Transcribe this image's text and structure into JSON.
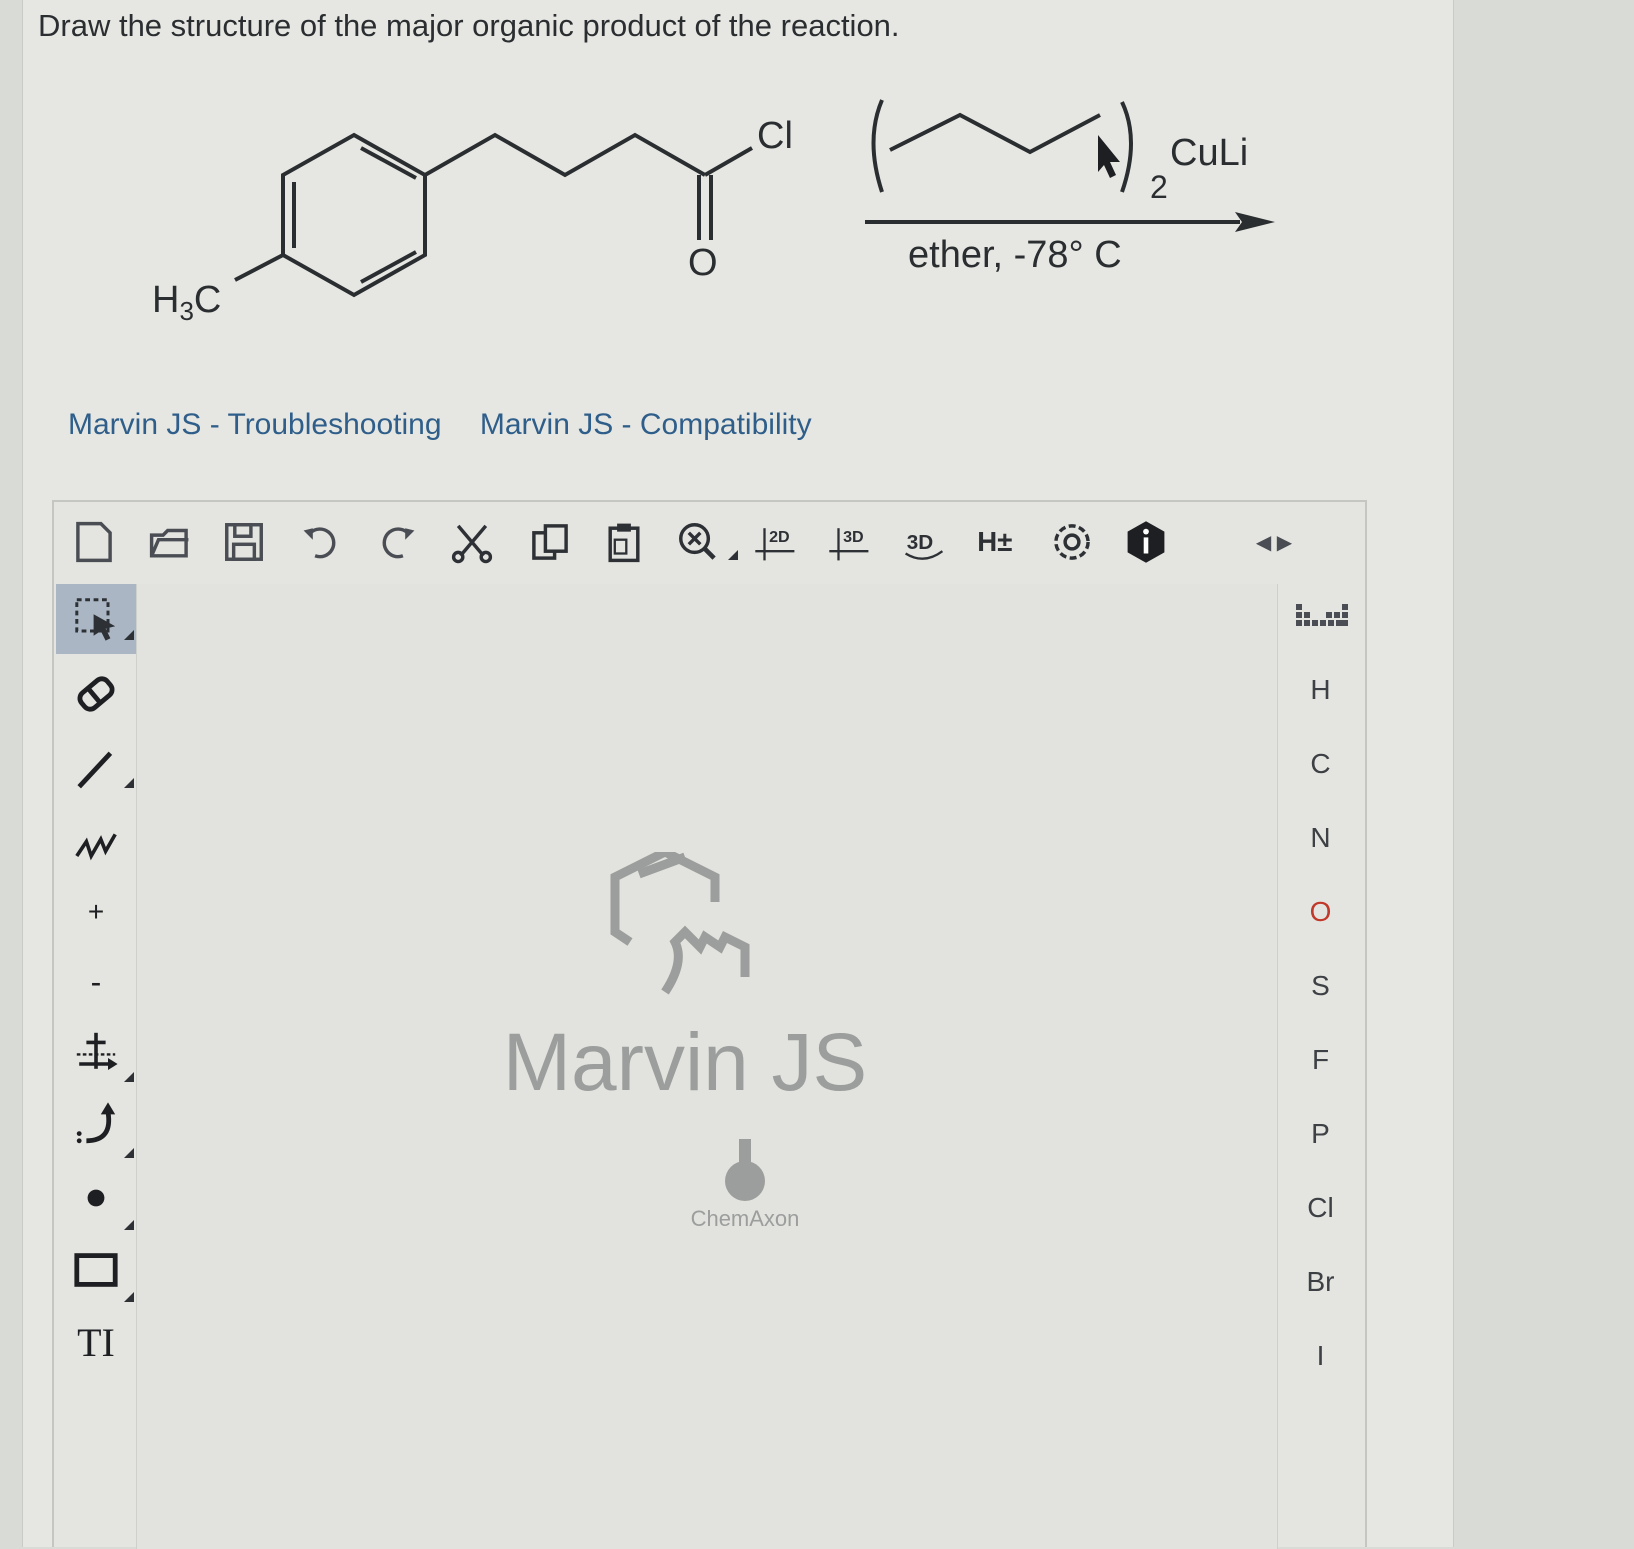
{
  "question": {
    "text": "Draw the structure of the major organic product of the reaction."
  },
  "reaction": {
    "reactant_labels": {
      "h3c": "H",
      "h3c_sub": "3",
      "h3c_c": "C",
      "cl": "Cl",
      "o": "O"
    },
    "reagent": {
      "cu": "CuLi",
      "subscript": "2"
    },
    "conditions": "ether, -78° C"
  },
  "links": [
    {
      "label": "Marvin JS - Troubleshooting"
    },
    {
      "label": "Marvin JS - Compatibility"
    }
  ],
  "toolbar": {
    "items": [
      "new-document-icon",
      "open-icon",
      "save-icon",
      "undo-icon",
      "redo-icon",
      "cut-icon",
      "copy-icon",
      "paste-icon",
      "zoom-icon",
      "clean-2d-icon",
      "clean-3d-icon",
      "3d-rotate-icon",
      "hydrogens-icon",
      "settings-icon",
      "info-icon"
    ],
    "labels": {
      "clean2d": "2D",
      "clean3d": "3D",
      "rot3d": "3D",
      "hydrogens": "H±"
    },
    "expand": "◀ ▶"
  },
  "left_toolbar": {
    "items": [
      "select-icon",
      "erase-icon",
      "single-bond-icon",
      "chain-icon",
      "increase-charge-icon",
      "decrease-charge-icon",
      "reaction-arrow-icon",
      "electron-flow-icon",
      "radical-icon",
      "rectangle-icon",
      "text-icon"
    ],
    "labels": {
      "plus": "+",
      "minus": "-",
      "text": "TI"
    }
  },
  "canvas": {
    "watermark": "Marvin JS",
    "vendor": "ChemAxon"
  },
  "periodic": {
    "elements": [
      "H",
      "C",
      "N",
      "O",
      "S",
      "F",
      "P",
      "Cl",
      "Br",
      "I"
    ]
  },
  "colors": {
    "oxygen": "#c0392b",
    "link": "#2f5e8a",
    "active_tool": "#aab6c3"
  }
}
